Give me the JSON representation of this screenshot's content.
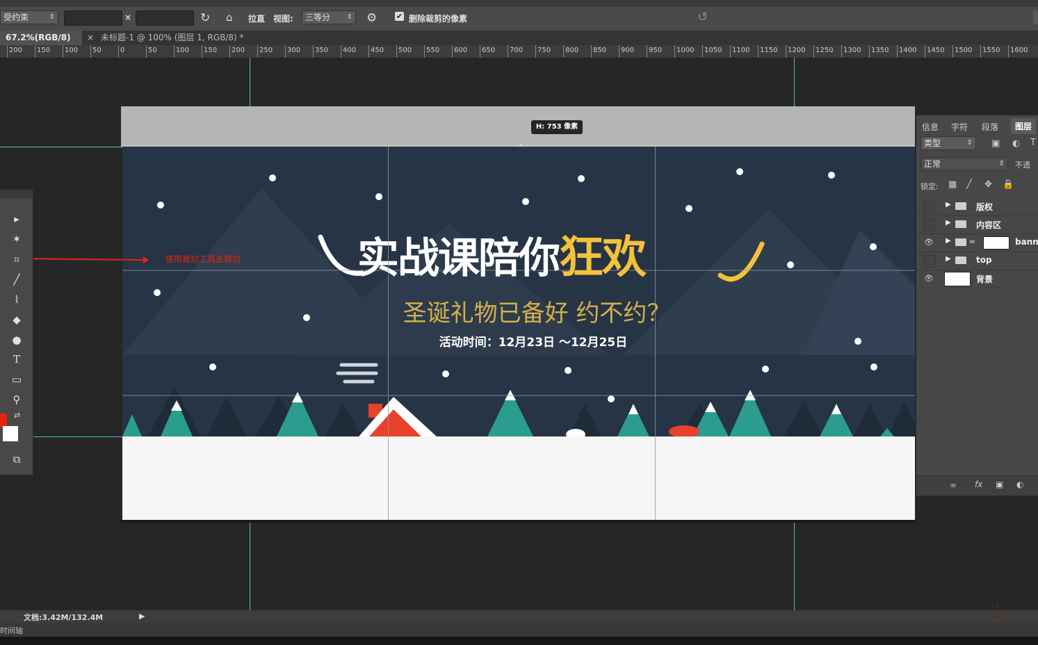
{
  "options_bar": {
    "constraint_label": "受约束",
    "swap_symbol": "×",
    "straighten_label": "拉直",
    "view_label": "视图:",
    "view_value": "三等分",
    "delete_pixels_label": "删除裁剪的像素",
    "delete_pixels_checked": "✔"
  },
  "tabs": [
    {
      "label": "67.2%(RGB/8) *"
    },
    {
      "label": "未标题-1 @ 100% (图层 1, RGB/8) *"
    }
  ],
  "tab_close": "×",
  "ruler_labels": [
    "200",
    "150",
    "100",
    "50",
    "0",
    "50",
    "100",
    "150",
    "200",
    "250",
    "300",
    "350",
    "400",
    "450",
    "500",
    "550",
    "600",
    "650",
    "700",
    "750",
    "800",
    "850",
    "900",
    "950",
    "1000",
    "1050",
    "1100",
    "1150",
    "1200",
    "1250",
    "1300",
    "1350",
    "1400",
    "1450",
    "1500",
    "1550",
    "1600"
  ],
  "crop_tooltip": "H: 753 像素",
  "annotation": "使用裁切工具去裁切",
  "banner": {
    "title_main": "实战课陪你",
    "title_accent": "狂欢",
    "subtitle": "圣诞礼物已备好 约不约？",
    "date_line": "活动时间：12月23日 ～12月25日"
  },
  "tool_labels": {
    "type": "T"
  },
  "layers_panel": {
    "tabs": [
      "信息",
      "字符",
      "段落",
      "图层"
    ],
    "kind_filter": "类型",
    "blend_mode": "正常",
    "opacity_label": "不透",
    "lock_label": "锁定:",
    "layers": [
      {
        "name": "版权",
        "visible": false
      },
      {
        "name": "内容区",
        "visible": false
      },
      {
        "name": "banner",
        "visible": true
      },
      {
        "name": "top",
        "visible": false
      },
      {
        "name": "背景",
        "visible": true
      }
    ],
    "eye_glyph": "👁"
  },
  "status": {
    "doc_size": "文档:3.42M/132.4M",
    "timeline_label": "时间轴"
  },
  "colors": {
    "foreground": "#e8230f",
    "background": "#ffffff",
    "guide": "#4fc3c8",
    "banner_bg": "#263445",
    "accent_yellow": "#f3c23a"
  },
  "icons": {
    "move": "move-icon",
    "magic_wand": "magic-wand-icon",
    "crop": "crop-icon",
    "brush": "brush-icon",
    "type": "type-icon",
    "zoom": "zoom-icon"
  }
}
